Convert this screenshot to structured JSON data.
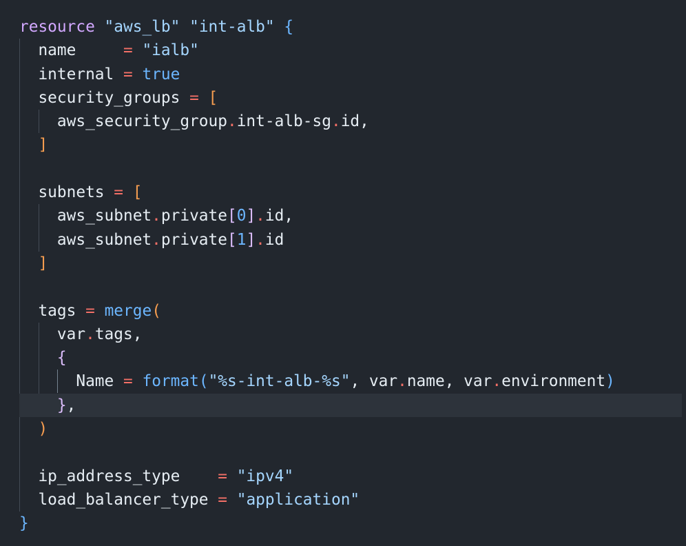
{
  "code": {
    "resource_keyword": "resource",
    "resource_type": "\"aws_lb\"",
    "resource_name": "\"int-alb\"",
    "open_brace": "{",
    "close_brace": "}",
    "name_key": "name",
    "name_value": "\"ialb\"",
    "internal_key": "internal",
    "internal_value": "true",
    "security_groups_key": "security_groups",
    "sg_ref_a": "aws_security_group",
    "sg_ref_b": "int-alb-sg",
    "sg_ref_c": "id",
    "subnets_key": "subnets",
    "subnet_ref_a": "aws_subnet",
    "subnet_ref_b": "private",
    "subnet_idx_0": "0",
    "subnet_idx_1": "1",
    "subnet_ref_c": "id",
    "tags_key": "tags",
    "merge_fn": "merge",
    "var_kw": "var",
    "tags_attr": "tags",
    "name_tag_key": "Name",
    "format_fn": "format",
    "format_str": "\"%s-int-alb-%s\"",
    "var_name_attr": "name",
    "var_env_attr": "environment",
    "ip_address_type_key": "ip_address_type",
    "ip_address_type_value": "\"ipv4\"",
    "lb_type_key": "load_balancer_type",
    "lb_type_value": "\"application\""
  },
  "colors": {
    "background": "#22272e",
    "current_line": "#2d333b",
    "keyword": "#d2a8ff",
    "string": "#a5d6ff",
    "operator": "#f47067",
    "bracket": "#f69d50"
  }
}
